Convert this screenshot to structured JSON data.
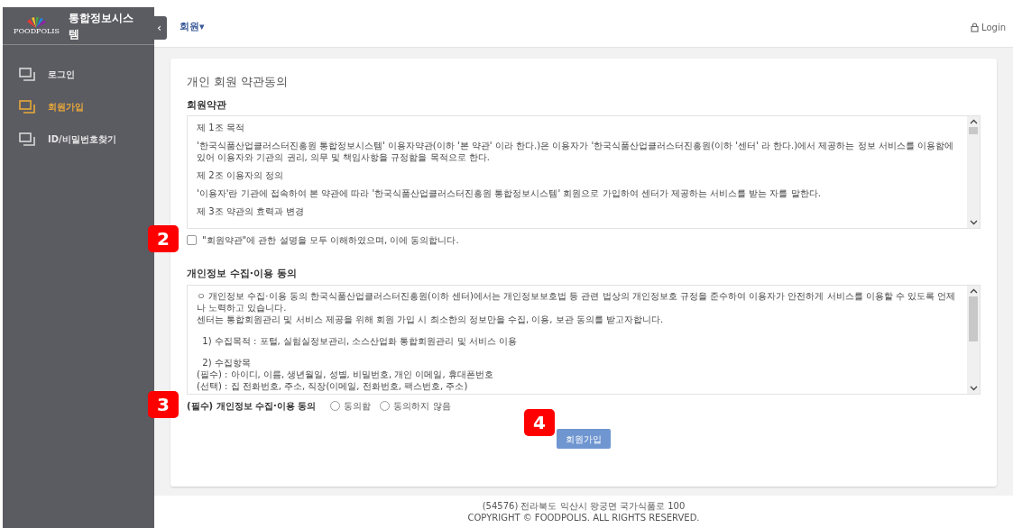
{
  "sidebar": {
    "logo_text": "FOODPOLIS",
    "title": "통합정보시스템",
    "collapse": "‹",
    "items": [
      {
        "label": "로그인",
        "selected": false
      },
      {
        "label": "회원가입",
        "selected": true
      },
      {
        "label": "ID/비밀번호찾기",
        "selected": false
      }
    ]
  },
  "header": {
    "menu": "회원",
    "menu_caret": "▾",
    "login": "Login"
  },
  "page_title": "개인 회원 약관동의",
  "terms": {
    "heading": "회원약관",
    "paragraphs": [
      "제 1조 목적",
      "'한국식품산업클러스터진흥원 통합정보시스템' 이용자약관(이하 '본 약관' 이라 한다.)은 이용자가 '한국식품산업클러스터진흥원(이하 '센터' 라 한다.)에서 제공하는 정보 서비스를 이용함에 있어 이용자와 기관의 권리, 의무 및 책임사항을 규정함을 목적으로 한다.",
      "제 2조 이용자의 정의",
      "'이용자'란 기관에 접속하여 본 약관에 따라 '한국식품산업클러스터진흥원 통합정보시스템' 회원으로 가입하여 센터가 제공하는 서비스를 받는 자를 말한다.",
      "제 3조 약관의 효력과 변경"
    ],
    "agree_label": "\"회원약관\"에 관한 설명을 모두 이해하였으며, 이에 동의합니다.",
    "checked": false,
    "badge": "2"
  },
  "privacy": {
    "heading": "개인정보 수집·이용 동의",
    "groups": [
      [
        "ㅇ 개인정보 수집·이용 동의 한국식품산업클러스터진흥원(이하 센터)에서는 개인정보보호법 등 관련 법상의 개인정보호 규정을 준수하여 이용자가 안전하게 서비스를 이용할 수 있도록 언제나 노력하고 있습니다.",
        "센터는 통합회원관리 및 서비스 제공을 위해 회원 가입 시 최소한의 정보만을 수집, 이용, 보관 동의를 받고자합니다."
      ],
      [
        "  1) 수집목적 : 포털, 실험실정보관리, 소스산업화 통합회원관리 및 서비스 이용"
      ],
      [
        "  2) 수집항목",
        "(필수) : 아이디, 이름, 생년월일, 성별, 비밀번호, 개인 이메일, 휴대폰번호",
        "(선택) : 집 전화번호, 주소, 직장(이메일, 전화번호, 팩스번호, 주소)"
      ]
    ],
    "consent_label": "(필수) 개인정보 수집·이용 동의",
    "options": [
      {
        "label": "동의함",
        "selected": false
      },
      {
        "label": "동의하지 않음",
        "selected": false
      }
    ],
    "badge": "3"
  },
  "submit": {
    "label": "회원가입",
    "badge": "4"
  },
  "footer": [
    "(54576) 전라북도 익산시 왕궁면 국가식품로 100",
    "COPYRIGHT © FOODPOLIS. ALL RIGHTS RESERVED."
  ]
}
